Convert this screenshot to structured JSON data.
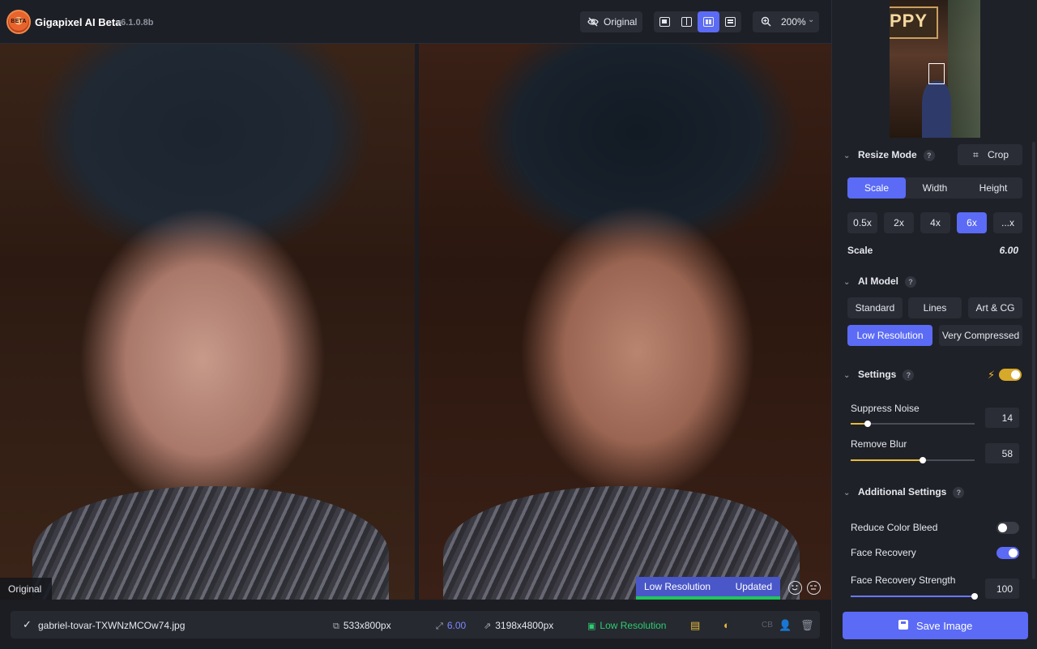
{
  "app": {
    "logo_text": "BETA",
    "title": "Gigapixel AI Beta",
    "version": "v6.1.0.8b"
  },
  "toolbar": {
    "original_label": "Original",
    "zoom_label": "200%",
    "view_modes": [
      "single-view",
      "split-view",
      "side-by-side-view",
      "grid-view"
    ],
    "active_view": "side-by-side-view"
  },
  "preview": {
    "left_label": "Original",
    "status_model": "Low Resolution",
    "status_state": "Updated"
  },
  "file": {
    "name": "gabriel-tovar-TXWNzMCOw74.jpg",
    "input_size": "533x800px",
    "scale": "6.00",
    "output_size": "3198x4800px",
    "model": "Low Resolution",
    "cb_label": "CB"
  },
  "panel": {
    "resize_mode": {
      "title": "Resize Mode",
      "help": "?",
      "crop_label": "Crop",
      "tabs": [
        "Scale",
        "Width",
        "Height"
      ],
      "active_tab": "Scale",
      "presets": [
        "0.5x",
        "2x",
        "4x",
        "6x",
        "...x"
      ],
      "active_preset": "6x",
      "scale_label": "Scale",
      "scale_value": "6.00"
    },
    "ai_model": {
      "title": "AI Model",
      "help": "?",
      "options": [
        "Standard",
        "Lines",
        "Art & CG",
        "Low Resolution",
        "Very Compressed"
      ],
      "active": "Low Resolution"
    },
    "settings": {
      "title": "Settings",
      "help": "?",
      "auto_enabled": true,
      "suppress_noise_label": "Suppress Noise",
      "suppress_noise_value": "14",
      "suppress_noise_fraction": 0.14,
      "remove_blur_label": "Remove Blur",
      "remove_blur_value": "58",
      "remove_blur_fraction": 0.58
    },
    "additional": {
      "title": "Additional Settings",
      "help": "?",
      "reduce_color_bleed_label": "Reduce Color Bleed",
      "reduce_color_bleed_on": false,
      "face_recovery_label": "Face Recovery",
      "face_recovery_on": true,
      "face_recovery_strength_label": "Face Recovery Strength",
      "face_recovery_strength_value": "100",
      "face_recovery_strength_fraction": 1.0
    },
    "save_label": "Save Image"
  },
  "colors": {
    "accent": "#5b6bf5",
    "success": "#2ecc71",
    "warning": "#e7b93a",
    "background": "#1b1d23"
  }
}
